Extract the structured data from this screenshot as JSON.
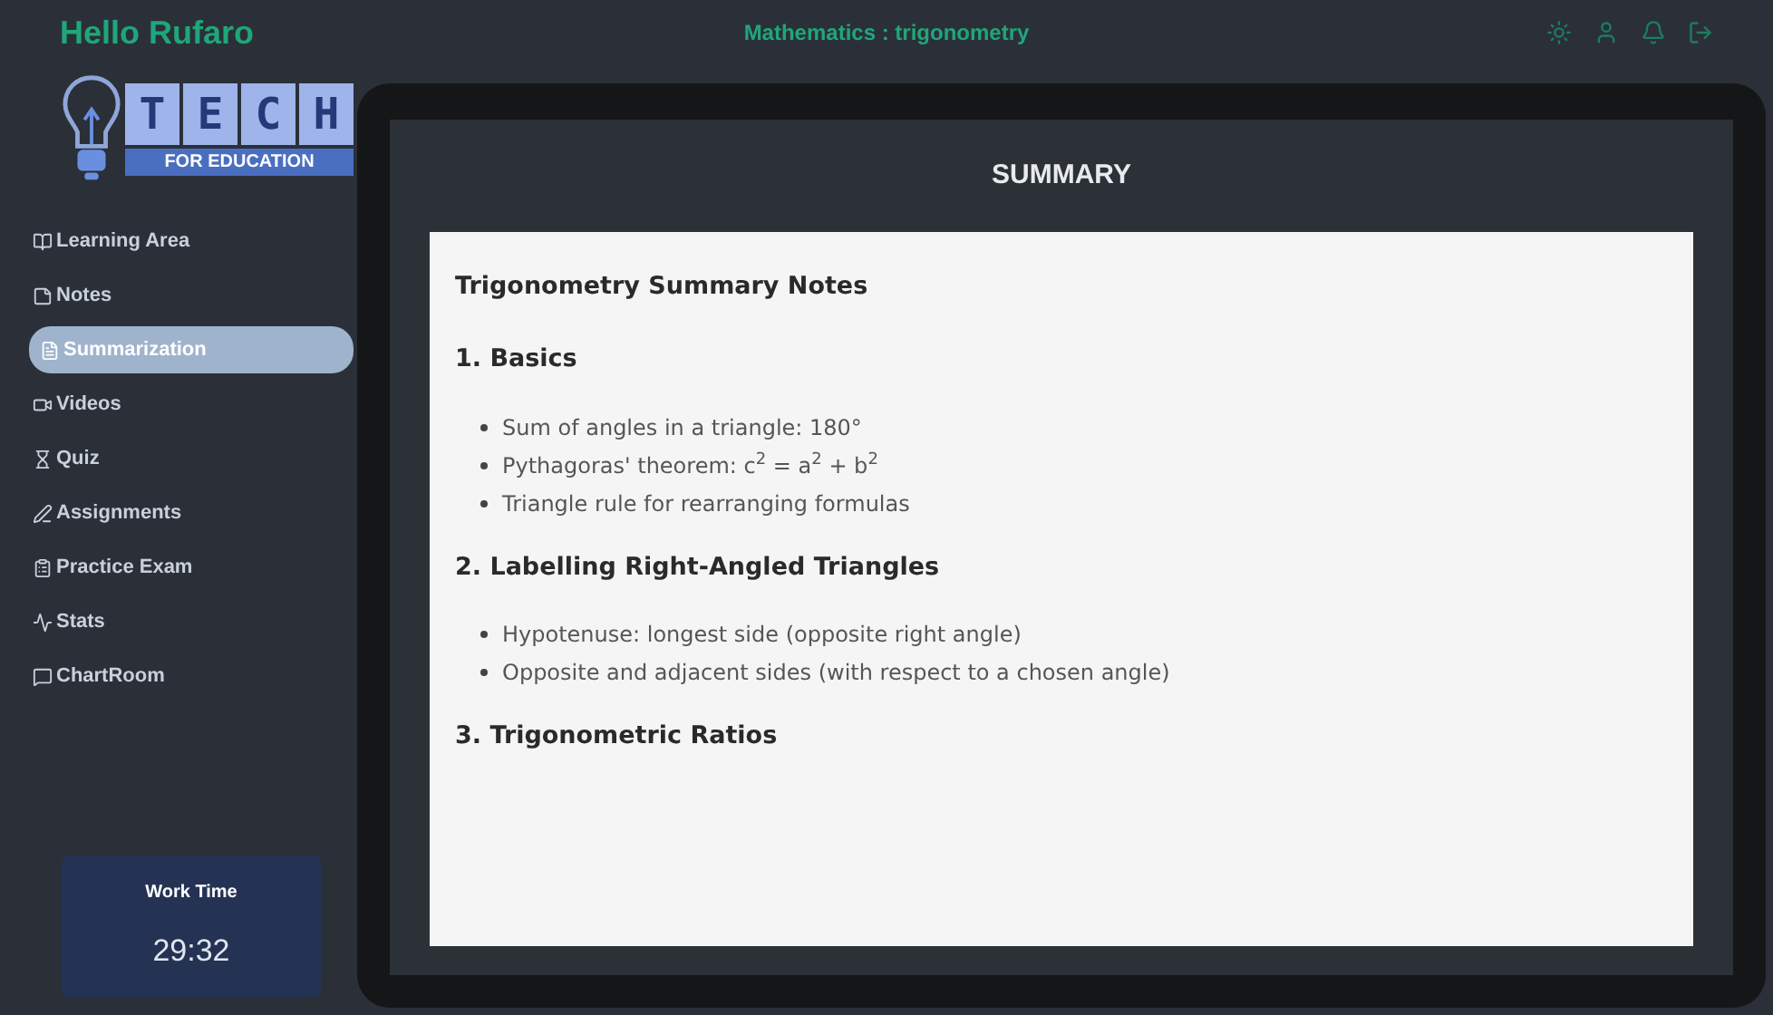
{
  "header": {
    "greeting": "Hello Rufaro",
    "subject": "Mathematics : trigonometry"
  },
  "logo": {
    "letters": [
      "T",
      "E",
      "C",
      "H"
    ],
    "subtitle": "FOR EDUCATION"
  },
  "sidebar": {
    "items": [
      {
        "label": "Learning Area",
        "selected": false
      },
      {
        "label": "Notes",
        "selected": false
      },
      {
        "label": "Summarization",
        "selected": true
      },
      {
        "label": "Videos",
        "selected": false
      },
      {
        "label": "Quiz",
        "selected": false
      },
      {
        "label": "Assignments",
        "selected": false
      },
      {
        "label": "Practice Exam",
        "selected": false
      },
      {
        "label": "Stats",
        "selected": false
      },
      {
        "label": "ChartRoom",
        "selected": false
      }
    ]
  },
  "work_time": {
    "label": "Work Time",
    "value": "29:32"
  },
  "summary": {
    "title": "SUMMARY",
    "blocks": [
      {
        "kind": "title",
        "text": "Trigonometry Summary Notes"
      },
      {
        "kind": "heading",
        "text": "1. Basics"
      },
      {
        "kind": "bullets",
        "items": [
          "Sum of angles in a triangle: 180°",
          "Pythagoras' theorem: c$^{2}$ = a$^{2}$ + b$^{2}$",
          "Triangle rule for rearranging formulas"
        ]
      },
      {
        "kind": "heading",
        "text": "2. Labelling Right-Angled Triangles"
      },
      {
        "kind": "bullets",
        "items": [
          "Hypotenuse: longest side (opposite right angle)",
          "Opposite and adjacent sides (with respect to a chosen angle)"
        ]
      },
      {
        "kind": "heading",
        "text": "3. Trigonometric Ratios"
      }
    ]
  }
}
